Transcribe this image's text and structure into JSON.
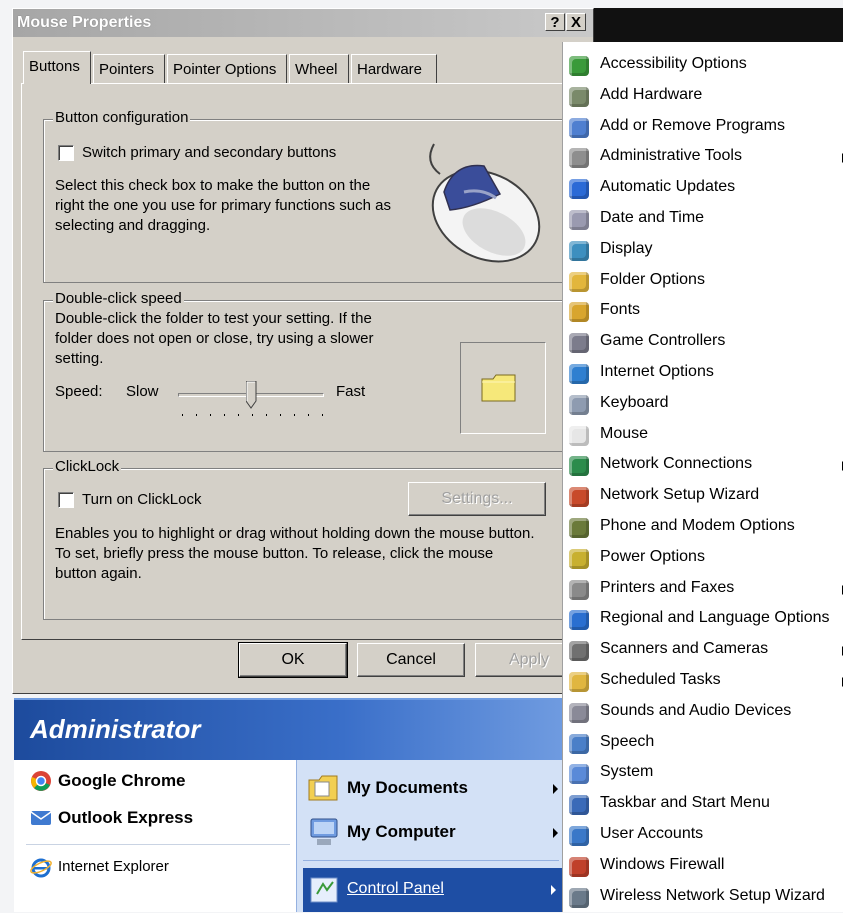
{
  "dialog": {
    "title": "Mouse Properties",
    "help_btn": "?",
    "close_btn": "X",
    "tabs": [
      "Buttons",
      "Pointers",
      "Pointer Options",
      "Wheel",
      "Hardware"
    ],
    "button_config": {
      "title": "Button configuration",
      "checkbox_label": "Switch primary and secondary buttons",
      "description": "Select this check box to make the button on the right the one you use for primary functions such as selecting and dragging."
    },
    "double_click": {
      "title": "Double-click speed",
      "description": "Double-click the folder to test your setting. If the folder does not open or close, try using a slower setting.",
      "speed_label": "Speed:",
      "slow": "Slow",
      "fast": "Fast",
      "slider_value": 0.5
    },
    "clicklock": {
      "title": "ClickLock",
      "checkbox_label": "Turn on ClickLock",
      "settings_btn": "Settings...",
      "description": "Enables you to highlight or drag without holding down the mouse button. To set, briefly press the mouse button. To release, click the mouse button again."
    },
    "buttons": {
      "ok": "OK",
      "cancel": "Cancel",
      "apply": "Apply"
    }
  },
  "start_menu": {
    "user": "Administrator",
    "pinned": [
      "Google Chrome",
      "Outlook Express"
    ],
    "recent": [
      "Internet Explorer"
    ],
    "right": [
      "My Documents",
      "My Computer",
      "Control Panel"
    ]
  },
  "control_panel_menu": {
    "items": [
      {
        "label": "Accessibility Options",
        "icon": "accessibility-icon",
        "color": "#3a9a3a",
        "arrow": false
      },
      {
        "label": "Add Hardware",
        "icon": "add-hardware-icon",
        "color": "#7a8a6a",
        "arrow": false
      },
      {
        "label": "Add or Remove Programs",
        "icon": "add-remove-programs-icon",
        "color": "#4f7fd0",
        "arrow": false
      },
      {
        "label": "Administrative Tools",
        "icon": "administrative-tools-icon",
        "color": "#8e8e8e",
        "arrow": true
      },
      {
        "label": "Automatic Updates",
        "icon": "automatic-updates-icon",
        "color": "#2b6ad6",
        "arrow": false
      },
      {
        "label": "Date and Time",
        "icon": "date-time-icon",
        "color": "#9a9ab0",
        "arrow": false
      },
      {
        "label": "Display",
        "icon": "display-icon",
        "color": "#3d8fbf",
        "arrow": false
      },
      {
        "label": "Folder Options",
        "icon": "folder-options-icon",
        "color": "#e2b63c",
        "arrow": false
      },
      {
        "label": "Fonts",
        "icon": "fonts-icon",
        "color": "#d8a52e",
        "arrow": false
      },
      {
        "label": "Game Controllers",
        "icon": "game-controllers-icon",
        "color": "#7c7c8c",
        "arrow": false
      },
      {
        "label": "Internet Options",
        "icon": "internet-options-icon",
        "color": "#2f7fd0",
        "arrow": false
      },
      {
        "label": "Keyboard",
        "icon": "keyboard-icon",
        "color": "#8e9bb0",
        "arrow": false
      },
      {
        "label": "Mouse",
        "icon": "mouse-icon",
        "color": "#e6e6e6",
        "arrow": false
      },
      {
        "label": "Network Connections",
        "icon": "network-connections-icon",
        "color": "#2c8c4c",
        "arrow": true
      },
      {
        "label": "Network Setup Wizard",
        "icon": "network-setup-wizard-icon",
        "color": "#c84a2a",
        "arrow": false
      },
      {
        "label": "Phone and Modem Options",
        "icon": "phone-modem-icon",
        "color": "#6a7a3a",
        "arrow": false
      },
      {
        "label": "Power Options",
        "icon": "power-options-icon",
        "color": "#c8b030",
        "arrow": false
      },
      {
        "label": "Printers and Faxes",
        "icon": "printers-faxes-icon",
        "color": "#8a8a8a",
        "arrow": true
      },
      {
        "label": "Regional and Language Options",
        "icon": "regional-language-icon",
        "color": "#2a6fd0",
        "arrow": false
      },
      {
        "label": "Scanners and Cameras",
        "icon": "scanners-cameras-icon",
        "color": "#707070",
        "arrow": true
      },
      {
        "label": "Scheduled Tasks",
        "icon": "scheduled-tasks-icon",
        "color": "#e0b640",
        "arrow": true
      },
      {
        "label": "Sounds and Audio Devices",
        "icon": "sounds-audio-icon",
        "color": "#8a8a98",
        "arrow": false
      },
      {
        "label": "Speech",
        "icon": "speech-icon",
        "color": "#4a7fc8",
        "arrow": false
      },
      {
        "label": "System",
        "icon": "system-icon",
        "color": "#5a8ad8",
        "arrow": false
      },
      {
        "label": "Taskbar and Start Menu",
        "icon": "taskbar-start-menu-icon",
        "color": "#3a6ab8",
        "arrow": false
      },
      {
        "label": "User Accounts",
        "icon": "user-accounts-icon",
        "color": "#3a78c8",
        "arrow": false
      },
      {
        "label": "Windows Firewall",
        "icon": "windows-firewall-icon",
        "color": "#c0402a",
        "arrow": false
      },
      {
        "label": "Wireless Network Setup Wizard",
        "icon": "wireless-network-icon",
        "color": "#6a7a8a",
        "arrow": false
      }
    ]
  }
}
